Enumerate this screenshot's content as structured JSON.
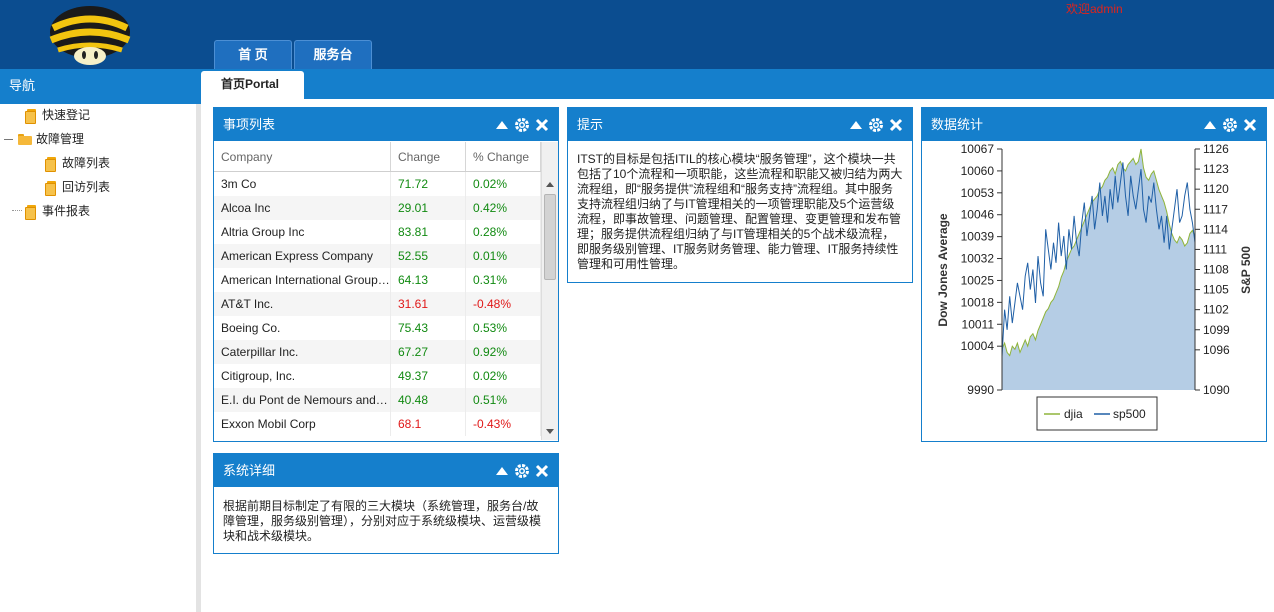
{
  "header": {
    "welcome": "欢迎admin",
    "tabs": [
      {
        "label": "首 页"
      },
      {
        "label": "服务台"
      }
    ]
  },
  "nav": {
    "title": "导航",
    "items": [
      {
        "label": "快速登记"
      },
      {
        "label": "故障管理"
      },
      {
        "label": "故障列表"
      },
      {
        "label": "回访列表"
      },
      {
        "label": "事件报表"
      }
    ]
  },
  "portal_tab": "首页Portal",
  "panels": {
    "items": {
      "title": "事项列表",
      "columns": [
        "Company",
        "Change",
        "% Change"
      ],
      "rows": [
        {
          "company": "3m Co",
          "change": "71.72",
          "pct": "0.02%",
          "positive": true
        },
        {
          "company": "Alcoa Inc",
          "change": "29.01",
          "pct": "0.42%",
          "positive": true
        },
        {
          "company": "Altria Group Inc",
          "change": "83.81",
          "pct": "0.28%",
          "positive": true
        },
        {
          "company": "American Express Company",
          "change": "52.55",
          "pct": "0.01%",
          "positive": true
        },
        {
          "company": "American International Group, Inc.",
          "change": "64.13",
          "pct": "0.31%",
          "positive": true
        },
        {
          "company": "AT&T Inc.",
          "change": "31.61",
          "pct": "-0.48%",
          "positive": false
        },
        {
          "company": "Boeing Co.",
          "change": "75.43",
          "pct": "0.53%",
          "positive": true
        },
        {
          "company": "Caterpillar Inc.",
          "change": "67.27",
          "pct": "0.92%",
          "positive": true
        },
        {
          "company": "Citigroup, Inc.",
          "change": "49.37",
          "pct": "0.02%",
          "positive": true
        },
        {
          "company": "E.I. du Pont de Nemours and Company",
          "change": "40.48",
          "pct": "0.51%",
          "positive": true
        },
        {
          "company": "Exxon Mobil Corp",
          "change": "68.1",
          "pct": "-0.43%",
          "positive": false
        }
      ]
    },
    "tips": {
      "title": "提示",
      "text": "ITST的目标是包括ITIL的核心模块“服务管理”，这个模块一共包括了10个流程和一项职能，这些流程和职能又被归结为两大流程组，即“服务提供”流程组和“服务支持”流程组。其中服务支持流程组归纳了与IT管理相关的一项管理职能及5个运营级流程，即事故管理、问题管理、配置管理、变更管理和发布管理；服务提供流程组归纳了与IT管理相关的5个战术级流程，即服务级别管理、IT服务财务管理、能力管理、IT服务持续性管理和可用性管理。"
    },
    "stats": {
      "title": "数据统计"
    },
    "details": {
      "title": "系统详细",
      "text": "根据前期目标制定了有限的三大模块（系统管理，服务台/故障管理，服务级别管理），分别对应于系统级模块、运营级模块和战术级模块。"
    }
  },
  "colors": {
    "header": "#0b4d90",
    "accent": "#157fcc",
    "positive": "#118a11",
    "negative": "#e01818",
    "area": "#b5cde5",
    "djia_line": "#8fb43a",
    "sp_line": "#1f5fa6"
  },
  "icons": [
    "collapse-icon",
    "gear-icon",
    "close-icon",
    "mushroom-logo",
    "folder-icon",
    "document-icon"
  ],
  "chart_data": {
    "type": "area",
    "ylabel_left": "Dow Jones Average",
    "ylabel_right": "S&P 500",
    "left_ticks": [
      "10067",
      "10060",
      "10053",
      "10046",
      "10039",
      "10032",
      "10025",
      "10018",
      "10011",
      "10004",
      "9990"
    ],
    "right_ticks": [
      "1126",
      "1123",
      "1120",
      "1117",
      "1114",
      "1111",
      "1108",
      "1105",
      "1102",
      "1099",
      "1096",
      "1090"
    ],
    "ylim_left": [
      9990,
      10067
    ],
    "ylim_right": [
      1090,
      1126
    ],
    "legend": [
      "djia",
      "sp500"
    ],
    "series": [
      {
        "name": "djia",
        "axis": "left",
        "values": [
          10003,
          10005,
          10002,
          10001,
          10004,
          10003,
          10005,
          10002,
          10004,
          10006,
          10004,
          10007,
          10008,
          10006,
          10009,
          10011,
          10013,
          10015,
          10016,
          10018,
          10019,
          10021,
          10023,
          10026,
          10028,
          10031,
          10033,
          10035,
          10036,
          10038,
          10040,
          10042,
          10044,
          10046,
          10048,
          10050,
          10051,
          10052,
          10054,
          10055,
          10057,
          10058,
          10060,
          10061,
          10059,
          10062,
          10063,
          10061,
          10060,
          10062,
          10063,
          10064,
          10062,
          10063,
          10067,
          10061,
          10058,
          10057,
          10059,
          10060,
          10057,
          10054,
          10052,
          10050,
          10047,
          10043,
          10040,
          10038,
          10037,
          10039,
          10038,
          10036,
          10037,
          10040,
          10041,
          10039
        ]
      },
      {
        "name": "sp500",
        "axis": "right",
        "values": [
          1095,
          1102,
          1099,
          1104,
          1100,
          1103,
          1106,
          1104,
          1102,
          1107,
          1109,
          1105,
          1108,
          1103,
          1110,
          1106,
          1104,
          1114,
          1111,
          1108,
          1112,
          1109,
          1115,
          1110,
          1113,
          1108,
          1114,
          1111,
          1116,
          1112,
          1110,
          1115,
          1118,
          1113,
          1116,
          1119,
          1114,
          1117,
          1121,
          1116,
          1119,
          1115,
          1120,
          1117,
          1122,
          1118,
          1121,
          1124,
          1119,
          1116,
          1122,
          1119,
          1117,
          1120,
          1123,
          1117,
          1115,
          1119,
          1118,
          1121,
          1117,
          1114,
          1116,
          1112,
          1116,
          1111,
          1114,
          1117,
          1120,
          1115,
          1116,
          1119,
          1121,
          1117,
          1115,
          1112
        ]
      }
    ]
  }
}
